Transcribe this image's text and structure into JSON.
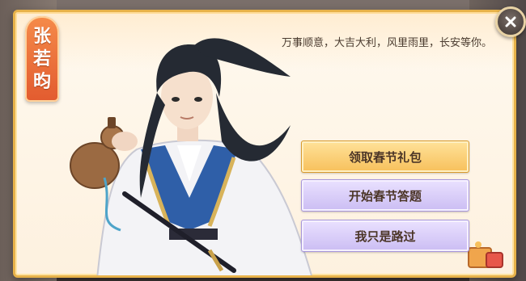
{
  "npc": {
    "name_chars": [
      "张",
      "若",
      "昀"
    ]
  },
  "dialogue": {
    "text": "万事顺意，大吉大利，风里雨里，长安等你。"
  },
  "options": [
    {
      "label": "领取春节礼包"
    },
    {
      "label": "开始春节答题"
    },
    {
      "label": "我只是路过"
    }
  ],
  "icons": {
    "close": "close-icon",
    "corner": "festival-ornament-icon"
  },
  "colors": {
    "accent_gold": "#f7c05b",
    "option_purple": "#cbbdf3",
    "banner_orange": "#e25b2f",
    "panel": "#fdf1df"
  }
}
